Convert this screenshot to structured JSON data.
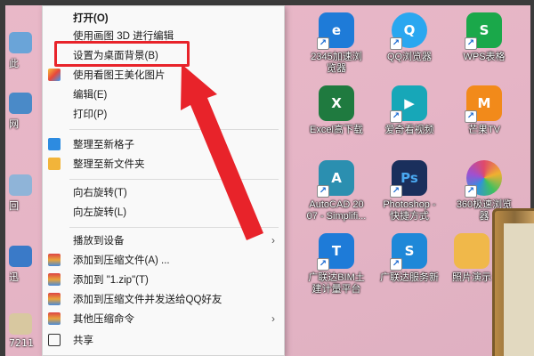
{
  "context_menu": {
    "items": [
      {
        "label": "打开(O)"
      },
      {
        "label": "使用画图 3D 进行编辑"
      },
      {
        "label": "设置为桌面背景(B)"
      },
      {
        "label": "使用看图王美化图片"
      },
      {
        "label": "编辑(E)"
      },
      {
        "label": "打印(P)"
      },
      {
        "label": "整理至新格子"
      },
      {
        "label": "整理至新文件夹"
      },
      {
        "label": "向右旋转(T)"
      },
      {
        "label": "向左旋转(L)"
      },
      {
        "label": "播放到设备"
      },
      {
        "label": "添加到压缩文件(A) ..."
      },
      {
        "label": "添加到 \"1.zip\"(T)"
      },
      {
        "label": "添加到压缩文件并发送给QQ好友"
      },
      {
        "label": "其他压缩命令"
      },
      {
        "label": "共享"
      }
    ],
    "submenu_arrow": "›"
  },
  "desktop_icons": [
    {
      "label": "2345加速浏\n览器",
      "icon": "browser-icon",
      "color": "#1e7bd8"
    },
    {
      "label": "QQ浏览器",
      "icon": "qq-browser-icon",
      "color": "#2aa7f0"
    },
    {
      "label": "WPS表格",
      "icon": "wps-sheet-icon",
      "color": "#1aa84a"
    },
    {
      "label": "Excel高下载",
      "icon": "excel-icon",
      "color": "#1f7a3f"
    },
    {
      "label": "爱奇看视频",
      "icon": "video-icon",
      "color": "#17a7b8"
    },
    {
      "label": "芒果TV",
      "icon": "mango-tv-icon",
      "color": "#f28a1a"
    },
    {
      "label": "AutoCAD 20\n07 - Simplifi...",
      "icon": "autocad-icon",
      "color": "#2b8fb0"
    },
    {
      "label": "Photoshop -\n快捷方式",
      "icon": "photoshop-icon",
      "color": "#1a2f5c"
    },
    {
      "label": "360极速浏览\n器",
      "icon": "360-browser-icon",
      "color": "#e04a6a"
    },
    {
      "label": "广联达BIM土\n建计量平台",
      "icon": "bim-icon",
      "color": "#1e7bd8"
    },
    {
      "label": "广联达服务新",
      "icon": "service-icon",
      "color": "#1e88d8"
    },
    {
      "label": "照片演示",
      "icon": "photo-icon",
      "color": "#f0b84a"
    }
  ],
  "edge_icons": [
    {
      "label": "此",
      "icon": "pc-icon"
    },
    {
      "label": "网",
      "icon": "network-icon"
    },
    {
      "label": "回",
      "icon": "recycle-icon"
    },
    {
      "label": "迅",
      "icon": "xunlei-icon"
    },
    {
      "label": "7211",
      "icon": "file-icon"
    }
  ],
  "colors": {
    "highlight": "#e8232a",
    "arrow": "#e8232a"
  }
}
